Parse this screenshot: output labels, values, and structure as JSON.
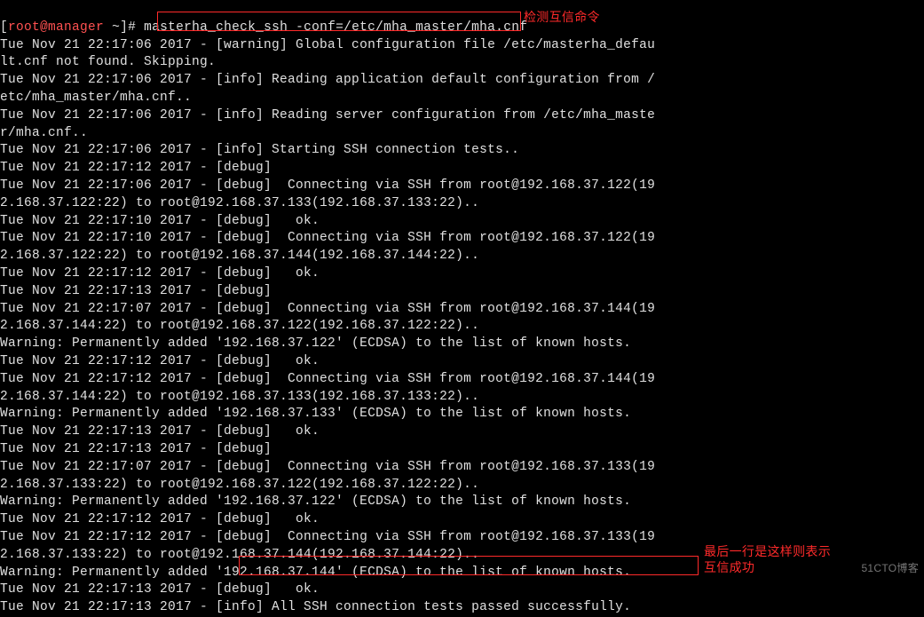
{
  "prompt": {
    "user": "root@manager",
    "cwd": "~",
    "symbol": "#",
    "command": "masterha_check_ssh -conf=/etc/mha_master/mha.cnf"
  },
  "annotations": {
    "top": "检测互信命令",
    "bottom_line1": "最后一行是这样则表示",
    "bottom_line2": "互信成功"
  },
  "lines": [
    "Tue Nov 21 22:17:06 2017 - [warning] Global configuration file /etc/masterha_defau",
    "lt.cnf not found. Skipping.",
    "Tue Nov 21 22:17:06 2017 - [info] Reading application default configuration from /",
    "etc/mha_master/mha.cnf..",
    "Tue Nov 21 22:17:06 2017 - [info] Reading server configuration from /etc/mha_maste",
    "r/mha.cnf..",
    "Tue Nov 21 22:17:06 2017 - [info] Starting SSH connection tests..",
    "Tue Nov 21 22:17:12 2017 - [debug] ",
    "Tue Nov 21 22:17:06 2017 - [debug]  Connecting via SSH from root@192.168.37.122(19",
    "2.168.37.122:22) to root@192.168.37.133(192.168.37.133:22)..",
    "Tue Nov 21 22:17:10 2017 - [debug]   ok.",
    "Tue Nov 21 22:17:10 2017 - [debug]  Connecting via SSH from root@192.168.37.122(19",
    "2.168.37.122:22) to root@192.168.37.144(192.168.37.144:22)..",
    "Tue Nov 21 22:17:12 2017 - [debug]   ok.",
    "Tue Nov 21 22:17:13 2017 - [debug] ",
    "Tue Nov 21 22:17:07 2017 - [debug]  Connecting via SSH from root@192.168.37.144(19",
    "2.168.37.144:22) to root@192.168.37.122(192.168.37.122:22)..",
    "Warning: Permanently added '192.168.37.122' (ECDSA) to the list of known hosts.",
    "Tue Nov 21 22:17:12 2017 - [debug]   ok.",
    "Tue Nov 21 22:17:12 2017 - [debug]  Connecting via SSH from root@192.168.37.144(19",
    "2.168.37.144:22) to root@192.168.37.133(192.168.37.133:22)..",
    "Warning: Permanently added '192.168.37.133' (ECDSA) to the list of known hosts.",
    "Tue Nov 21 22:17:13 2017 - [debug]   ok.",
    "Tue Nov 21 22:17:13 2017 - [debug] ",
    "Tue Nov 21 22:17:07 2017 - [debug]  Connecting via SSH from root@192.168.37.133(19",
    "2.168.37.133:22) to root@192.168.37.122(192.168.37.122:22)..",
    "Warning: Permanently added '192.168.37.122' (ECDSA) to the list of known hosts.",
    "Tue Nov 21 22:17:12 2017 - [debug]   ok.",
    "Tue Nov 21 22:17:12 2017 - [debug]  Connecting via SSH from root@192.168.37.133(19",
    "2.168.37.133:22) to root@192.168.37.144(192.168.37.144:22)..",
    "Warning: Permanently added '192.168.37.144' (ECDSA) to the list of known hosts.",
    "Tue Nov 21 22:17:13 2017 - [debug]   ok.",
    "Tue Nov 21 22:17:13 2017 - [info] All SSH connection tests passed successfully."
  ],
  "watermark": "51CTO博客"
}
